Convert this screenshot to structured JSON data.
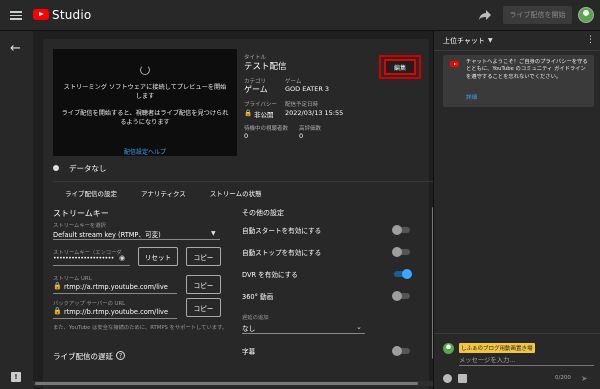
{
  "app": {
    "studio_label": "Studio",
    "top_button_label": "ライブ配信を開始"
  },
  "preview": {
    "message1": "ストリーミング ソフトウェアに接続してプレビューを開始します",
    "message2": "ライブ配信を開始すると、視聴者はライブ配信を見つけられるようになります",
    "help_link": "配信設定ヘルプ"
  },
  "stream_info": {
    "title_label": "タイトル",
    "title_value": "テスト配信",
    "edit_label": "編集",
    "category_label": "カテゴリ",
    "category_value": "ゲーム",
    "game_label": "ゲーム",
    "game_value": "GOD EATER 3",
    "privacy_label": "プライバシー",
    "privacy_value": "非公開",
    "scheduled_label": "配信予定日時",
    "scheduled_value": "2022/03/13 15:55",
    "waiting_label": "待機中の視聴者数",
    "waiting_value": "0",
    "likes_label": "高評価数",
    "likes_value": "0",
    "data_status": "データなし"
  },
  "tabs": [
    {
      "label": "ライブ配信の設定"
    },
    {
      "label": "アナリティクス"
    },
    {
      "label": "ストリームの状態"
    }
  ],
  "stream_key": {
    "section_title": "ストリームキー",
    "select_label": "ストリームキーを選択",
    "select_value": "Default stream key (RTMP、可変)",
    "key_label": "ストリームキー（エンコーダ",
    "key_value": "••••••••••••••••••••",
    "reset_label": "リセット",
    "copy_label": "コピー",
    "url_label": "ストリーム URL",
    "url_value": "rtmp://a.rtmp.youtube.com/live",
    "backup_label": "バックアップ サーバーの URL",
    "backup_value": "rtmp://b.rtmp.youtube.com/live",
    "note": "また、YouTube は安全な接続のために、RTMPS をサポートしています。",
    "latency_title": "ライブ配信の遅延"
  },
  "other_settings": {
    "section_title": "その他の設定",
    "items": [
      {
        "label": "自動スタートを有効にする",
        "on": false
      },
      {
        "label": "自動ストップを有効にする",
        "on": false
      },
      {
        "label": "DVR を有効にする",
        "on": true
      },
      {
        "label": "360° 動画",
        "on": false
      }
    ],
    "delay_label": "遅延の追加",
    "delay_value": "なし",
    "captions_label": "字幕",
    "captions_on": false
  },
  "chat": {
    "header": "上位チャット",
    "welcome_text": "チャットへようこそ！ご自身のプライバシーを守るとともに、YouTube のコミュニティ ガイドラインを遵守することを忘れないでください。",
    "welcome_link": "詳細",
    "user_name": "しふぁのブログ用動画置き場",
    "placeholder": "メッセージを入力...",
    "char_count": "0/200"
  },
  "colors": {
    "accent": "#3ea6ff",
    "brand_red": "#ff0000",
    "highlight_border": "#e60000"
  }
}
